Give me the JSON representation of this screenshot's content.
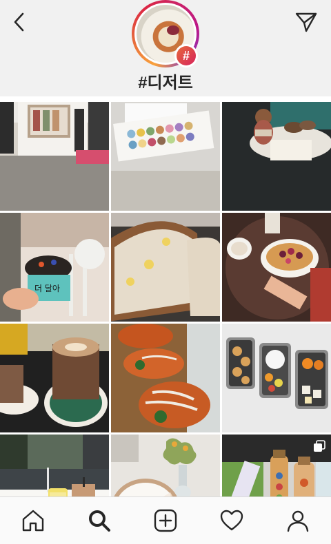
{
  "header": {
    "title": "#디저트",
    "badge_symbol": "#",
    "back_icon": "chevron-left-icon",
    "send_icon": "paper-plane-icon",
    "gradient_colors": [
      "#f9a23c",
      "#dc2743",
      "#bc1888"
    ]
  },
  "grid": {
    "tiles": [
      {
        "subject": "storefront"
      },
      {
        "subject": "macaron-box"
      },
      {
        "subject": "teddy-bear-dessert"
      },
      {
        "subject": "ice-cream-cup",
        "text": "더 달아"
      },
      {
        "subject": "bread-loaf"
      },
      {
        "subject": "berry-waffle"
      },
      {
        "subject": "latte"
      },
      {
        "subject": "pizza-bread"
      },
      {
        "subject": "bento-boxes"
      },
      {
        "subject": "iced-drinks"
      },
      {
        "subject": "cake-slice"
      },
      {
        "subject": "juice-bottles",
        "multi": true
      }
    ]
  },
  "tabbar": {
    "items": [
      "home-icon",
      "search-icon",
      "add-post-icon",
      "activity-heart-icon",
      "profile-icon"
    ],
    "active": "search-icon"
  }
}
